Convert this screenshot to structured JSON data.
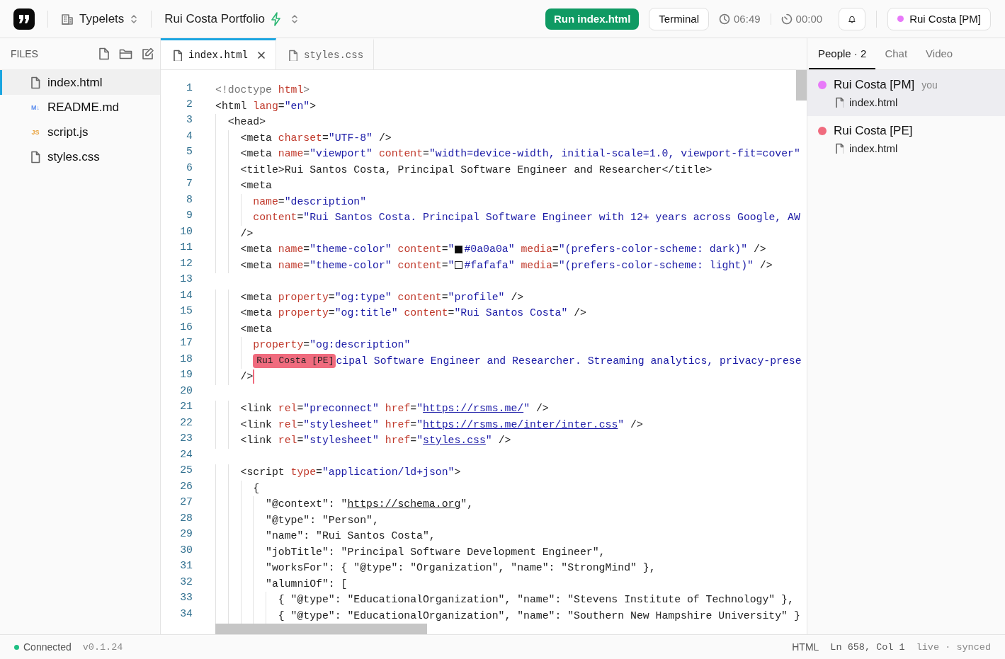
{
  "header": {
    "workspace": "Typelets",
    "project": "Rui Costa Portfolio",
    "run_button": "Run index.html",
    "terminal_button": "Terminal",
    "clock": "06:49",
    "timer": "00:00",
    "user": {
      "name": "Rui Costa [PM]",
      "color": "#e879f9"
    }
  },
  "sidebar": {
    "title": "FILES",
    "files": [
      {
        "name": "index.html",
        "kind": "file",
        "selected": true
      },
      {
        "name": "README.md",
        "kind": "markdown",
        "badge": "M↓",
        "selected": false
      },
      {
        "name": "script.js",
        "kind": "script",
        "badge": "JS",
        "selected": false
      },
      {
        "name": "styles.css",
        "kind": "file",
        "selected": false
      }
    ]
  },
  "editor": {
    "tabs": [
      {
        "label": "index.html",
        "selected": true
      },
      {
        "label": "styles.css",
        "selected": false
      }
    ],
    "lines": [
      {
        "number": "1",
        "tokens": [
          {
            "kind": "punct",
            "text": "<!doctype "
          },
          {
            "kind": "attr",
            "text": "html"
          },
          {
            "kind": "punct",
            "text": ">"
          }
        ]
      },
      {
        "number": "2",
        "tokens": [
          {
            "kind": "tag",
            "text": "<html "
          },
          {
            "kind": "attr",
            "text": "lang"
          },
          {
            "kind": "text",
            "text": "="
          },
          {
            "kind": "str",
            "text": "\"en\""
          },
          {
            "kind": "tag",
            "text": ">"
          }
        ]
      },
      {
        "number": "3",
        "tokens": [
          {
            "kind": "tag",
            "text": "  <head>"
          }
        ]
      },
      {
        "number": "4",
        "tokens": [
          {
            "kind": "tag",
            "text": "    <meta "
          },
          {
            "kind": "attr",
            "text": "charset"
          },
          {
            "kind": "text",
            "text": "="
          },
          {
            "kind": "str",
            "text": "\"UTF-8\""
          },
          {
            "kind": "tag",
            "text": " />"
          }
        ]
      },
      {
        "number": "5",
        "tokens": [
          {
            "kind": "tag",
            "text": "    <meta "
          },
          {
            "kind": "attr",
            "text": "name"
          },
          {
            "kind": "text",
            "text": "="
          },
          {
            "kind": "str",
            "text": "\"viewport\" "
          },
          {
            "kind": "attr",
            "text": "content"
          },
          {
            "kind": "text",
            "text": "="
          },
          {
            "kind": "str",
            "text": "\"width=device-width, initial-scale=1.0, viewport-fit=cover\""
          }
        ]
      },
      {
        "number": "6",
        "tokens": [
          {
            "kind": "tag",
            "text": "    <title>"
          },
          {
            "kind": "text",
            "text": "Rui Santos Costa, Principal Software Engineer and Researcher"
          },
          {
            "kind": "tag",
            "text": "</title>"
          }
        ]
      },
      {
        "number": "7",
        "tokens": [
          {
            "kind": "tag",
            "text": "    <meta"
          }
        ]
      },
      {
        "number": "8",
        "tokens": [
          {
            "kind": "attr",
            "text": "      name"
          },
          {
            "kind": "text",
            "text": "="
          },
          {
            "kind": "str",
            "text": "\"description\""
          }
        ]
      },
      {
        "number": "9",
        "tokens": [
          {
            "kind": "attr",
            "text": "      content"
          },
          {
            "kind": "text",
            "text": "="
          },
          {
            "kind": "str",
            "text": "\"Rui Santos Costa. Principal Software Engineer with 12+ years across Google, AW"
          }
        ]
      },
      {
        "number": "10",
        "tokens": [
          {
            "kind": "tag",
            "text": "    />"
          }
        ]
      },
      {
        "number": "11",
        "tokens": [
          {
            "kind": "tag",
            "text": "    <meta "
          },
          {
            "kind": "attr",
            "text": "name"
          },
          {
            "kind": "text",
            "text": "="
          },
          {
            "kind": "str",
            "text": "\"theme-color\" "
          },
          {
            "kind": "attr",
            "text": "content"
          },
          {
            "kind": "text",
            "text": "="
          },
          {
            "kind": "str",
            "text": "\""
          },
          {
            "kind": "swatch",
            "color": "#0a0a0a"
          },
          {
            "kind": "str",
            "text": "#0a0a0a\" "
          },
          {
            "kind": "attr",
            "text": "media"
          },
          {
            "kind": "text",
            "text": "="
          },
          {
            "kind": "str",
            "text": "\"(prefers-color-scheme: dark)\""
          },
          {
            "kind": "tag",
            "text": " />"
          }
        ]
      },
      {
        "number": "12",
        "tokens": [
          {
            "kind": "tag",
            "text": "    <meta "
          },
          {
            "kind": "attr",
            "text": "name"
          },
          {
            "kind": "text",
            "text": "="
          },
          {
            "kind": "str",
            "text": "\"theme-color\" "
          },
          {
            "kind": "attr",
            "text": "content"
          },
          {
            "kind": "text",
            "text": "="
          },
          {
            "kind": "str",
            "text": "\""
          },
          {
            "kind": "swatch",
            "color": "#fafafa"
          },
          {
            "kind": "str",
            "text": "#fafafa\" "
          },
          {
            "kind": "attr",
            "text": "media"
          },
          {
            "kind": "text",
            "text": "="
          },
          {
            "kind": "str",
            "text": "\"(prefers-color-scheme: light)\""
          },
          {
            "kind": "tag",
            "text": " />"
          }
        ]
      },
      {
        "number": "13"
      },
      {
        "number": "14",
        "tokens": [
          {
            "kind": "tag",
            "text": "    <meta "
          },
          {
            "kind": "attr",
            "text": "property"
          },
          {
            "kind": "text",
            "text": "="
          },
          {
            "kind": "str",
            "text": "\"og:type\" "
          },
          {
            "kind": "attr",
            "text": "content"
          },
          {
            "kind": "text",
            "text": "="
          },
          {
            "kind": "str",
            "text": "\"profile\""
          },
          {
            "kind": "tag",
            "text": " />"
          }
        ]
      },
      {
        "number": "15",
        "tokens": [
          {
            "kind": "tag",
            "text": "    <meta "
          },
          {
            "kind": "attr",
            "text": "property"
          },
          {
            "kind": "text",
            "text": "="
          },
          {
            "kind": "str",
            "text": "\"og:title\" "
          },
          {
            "kind": "attr",
            "text": "content"
          },
          {
            "kind": "text",
            "text": "="
          },
          {
            "kind": "str",
            "text": "\"Rui Santos Costa\""
          },
          {
            "kind": "tag",
            "text": " />"
          }
        ]
      },
      {
        "number": "16",
        "tokens": [
          {
            "kind": "tag",
            "text": "    <meta"
          }
        ]
      },
      {
        "number": "17",
        "tokens": [
          {
            "kind": "attr",
            "text": "      property"
          },
          {
            "kind": "text",
            "text": "="
          },
          {
            "kind": "str",
            "text": "\"og:description\""
          }
        ]
      },
      {
        "number": "18",
        "tokens": [
          {
            "kind": "cursor-label",
            "text": "Rui Costa [PE]",
            "color": "#f06b7e"
          },
          {
            "kind": "str",
            "text": "cipal Software Engineer and Researcher. Streaming analytics, privacy-prese"
          }
        ]
      },
      {
        "number": "19",
        "tokens": [
          {
            "kind": "tag",
            "text": "    />"
          },
          {
            "kind": "caret",
            "color": "#f06b7e"
          }
        ]
      },
      {
        "number": "20"
      },
      {
        "number": "21",
        "tokens": [
          {
            "kind": "tag",
            "text": "    <link "
          },
          {
            "kind": "attr",
            "text": "rel"
          },
          {
            "kind": "text",
            "text": "="
          },
          {
            "kind": "str",
            "text": "\"preconnect\" "
          },
          {
            "kind": "attr",
            "text": "href"
          },
          {
            "kind": "text",
            "text": "="
          },
          {
            "kind": "str",
            "text": "\""
          },
          {
            "kind": "link",
            "text": "https://rsms.me/"
          },
          {
            "kind": "str",
            "text": "\""
          },
          {
            "kind": "tag",
            "text": " />"
          }
        ]
      },
      {
        "number": "22",
        "tokens": [
          {
            "kind": "tag",
            "text": "    <link "
          },
          {
            "kind": "attr",
            "text": "rel"
          },
          {
            "kind": "text",
            "text": "="
          },
          {
            "kind": "str",
            "text": "\"stylesheet\" "
          },
          {
            "kind": "attr",
            "text": "href"
          },
          {
            "kind": "text",
            "text": "="
          },
          {
            "kind": "str",
            "text": "\""
          },
          {
            "kind": "link",
            "text": "https://rsms.me/inter/inter.css"
          },
          {
            "kind": "str",
            "text": "\""
          },
          {
            "kind": "tag",
            "text": " />"
          }
        ]
      },
      {
        "number": "23",
        "tokens": [
          {
            "kind": "tag",
            "text": "    <link "
          },
          {
            "kind": "attr",
            "text": "rel"
          },
          {
            "kind": "text",
            "text": "="
          },
          {
            "kind": "str",
            "text": "\"stylesheet\" "
          },
          {
            "kind": "attr",
            "text": "href"
          },
          {
            "kind": "text",
            "text": "="
          },
          {
            "kind": "str",
            "text": "\""
          },
          {
            "kind": "link",
            "text": "styles.css"
          },
          {
            "kind": "str",
            "text": "\""
          },
          {
            "kind": "tag",
            "text": " />"
          }
        ]
      },
      {
        "number": "24"
      },
      {
        "number": "25",
        "tokens": [
          {
            "kind": "tag",
            "text": "    <script "
          },
          {
            "kind": "attr",
            "text": "type"
          },
          {
            "kind": "text",
            "text": "="
          },
          {
            "kind": "str",
            "text": "\"application/ld+json\""
          },
          {
            "kind": "tag",
            "text": ">"
          }
        ]
      },
      {
        "number": "26",
        "tokens": [
          {
            "kind": "text",
            "text": "      {"
          }
        ]
      },
      {
        "number": "27",
        "tokens": [
          {
            "kind": "text",
            "text": "        \"@context\": \""
          },
          {
            "kind": "link",
            "text": "https://schema.org"
          },
          {
            "kind": "text",
            "text": "\","
          }
        ]
      },
      {
        "number": "28",
        "tokens": [
          {
            "kind": "text",
            "text": "        \"@type\": \"Person\","
          }
        ]
      },
      {
        "number": "29",
        "tokens": [
          {
            "kind": "text",
            "text": "        \"name\": \"Rui Santos Costa\","
          }
        ]
      },
      {
        "number": "30",
        "tokens": [
          {
            "kind": "text",
            "text": "        \"jobTitle\": \"Principal Software Development Engineer\","
          }
        ]
      },
      {
        "number": "31",
        "tokens": [
          {
            "kind": "text",
            "text": "        \"worksFor\": { \"@type\": \"Organization\", \"name\": \"StrongMind\" },"
          }
        ]
      },
      {
        "number": "32",
        "tokens": [
          {
            "kind": "text",
            "text": "        \"alumniOf\": ["
          }
        ]
      },
      {
        "number": "33",
        "tokens": [
          {
            "kind": "text",
            "text": "          { \"@type\": \"EducationalOrganization\", \"name\": \"Stevens Institute of Technology\" },"
          }
        ]
      },
      {
        "number": "34",
        "tokens": [
          {
            "kind": "text",
            "text": "          { \"@type\": \"EducationalOrganization\", \"name\": \"Southern New Hampshire University\" }"
          }
        ]
      }
    ]
  },
  "people_panel": {
    "tabs": [
      {
        "label": "People · 2",
        "selected": true
      },
      {
        "label": "Chat",
        "selected": false
      },
      {
        "label": "Video",
        "selected": false
      }
    ],
    "people": [
      {
        "name": "Rui Costa [PM]",
        "color": "#e879f9",
        "tag": "you",
        "file": "index.html",
        "selected": true
      },
      {
        "name": "Rui Costa [PE]",
        "color": "#f06b7e",
        "file": "index.html",
        "selected": false
      }
    ]
  },
  "status_bar": {
    "connection": "Connected",
    "connected": true,
    "version": "v0.1.24",
    "language": "HTML",
    "position": "Ln 658, Col 1",
    "sync": "live · synced"
  }
}
